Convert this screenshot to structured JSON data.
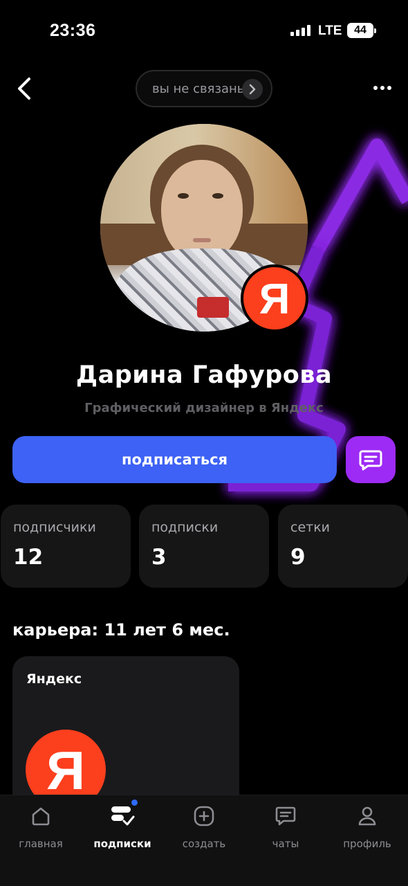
{
  "status_bar": {
    "time": "23:36",
    "network": "LTE",
    "battery": "44"
  },
  "header": {
    "connection_label": "вы не связаны"
  },
  "profile": {
    "name": "Дарина Гафурова",
    "subtitle": "Графический дизайнер в Яндекс",
    "badge_letter": "Я"
  },
  "actions": {
    "subscribe_label": "подписаться"
  },
  "stats": [
    {
      "label": "подписчики",
      "value": "12"
    },
    {
      "label": "подписки",
      "value": "3"
    },
    {
      "label": "сетки",
      "value": "9"
    }
  ],
  "career": {
    "title": "карьера: 11 лет 6 мес.",
    "company": "Яндекс",
    "logo_letter": "Я"
  },
  "tabbar": [
    {
      "label": "главная",
      "icon": "home-icon",
      "active": false
    },
    {
      "label": "подписки",
      "icon": "subscriptions-icon",
      "active": true,
      "badge": true
    },
    {
      "label": "создать",
      "icon": "plus-square-icon",
      "active": false
    },
    {
      "label": "чаты",
      "icon": "chat-icon",
      "active": false
    },
    {
      "label": "профиль",
      "icon": "user-icon",
      "active": false
    }
  ],
  "colors": {
    "background": "#000000",
    "primary_button": "#3d62f5",
    "chat_button": "#9d2bf5",
    "yandex_red": "#fc3f1d",
    "card": "#161617",
    "neon": "#9b3df5"
  }
}
